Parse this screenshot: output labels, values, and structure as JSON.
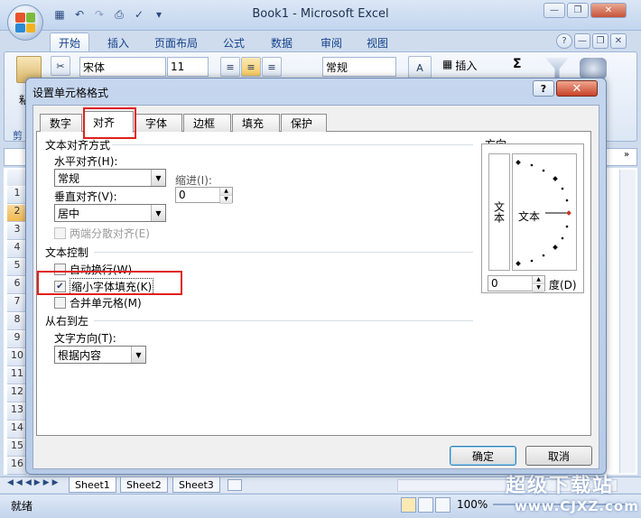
{
  "app": {
    "title": "Book1 - Microsoft Excel",
    "tabs": [
      "开始",
      "插入",
      "页面布局",
      "公式",
      "数据",
      "审阅",
      "视图"
    ],
    "active_tab": 0,
    "ribbon": {
      "font_name": "宋体",
      "font_size": "11",
      "number_format": "常规",
      "insert_label": "插入",
      "sum_glyph": "Σ",
      "paste_fragment": "粘",
      "clipboard_fragment": "剪"
    },
    "row_numbers": [
      "1",
      "2",
      "3",
      "4",
      "5",
      "6",
      "7",
      "8",
      "9",
      "10",
      "11",
      "12",
      "13",
      "14",
      "15",
      "16"
    ],
    "sheets": [
      "Sheet1",
      "Sheet2",
      "Sheet3"
    ],
    "status": {
      "ready": "就绪",
      "zoom": "100%"
    },
    "watermark": {
      "line1": "超级下载站",
      "line2": "www.CJXZ.com"
    }
  },
  "dialog": {
    "title": "设置单元格格式",
    "help": "?",
    "close": "✕",
    "tabs": [
      "数字",
      "对齐",
      "字体",
      "边框",
      "填充",
      "保护"
    ],
    "active_tab": 1,
    "align": {
      "section": "文本对齐方式",
      "horizontal_label": "水平对齐(H):",
      "horizontal_value": "常规",
      "indent_label": "缩进(I):",
      "indent_value": "0",
      "vertical_label": "垂直对齐(V):",
      "vertical_value": "居中",
      "justify_distributed": "两端分散对齐(E)"
    },
    "control": {
      "section": "文本控制",
      "wrap": "自动换行(W)",
      "wrap_checked": false,
      "shrink": "缩小字体填充(K)",
      "shrink_checked": true,
      "merge": "合并单元格(M)",
      "merge_checked": false
    },
    "rtl": {
      "section": "从右到左",
      "direction_label": "文字方向(T):",
      "direction_value": "根据内容"
    },
    "orientation": {
      "section": "方向",
      "vertical_text": "文本",
      "dial_text": "文本",
      "degrees_value": "0",
      "degrees_label": "度(D)"
    },
    "buttons": {
      "ok": "确定",
      "cancel": "取消"
    },
    "colors": {
      "highlight": "#e0201e"
    }
  }
}
